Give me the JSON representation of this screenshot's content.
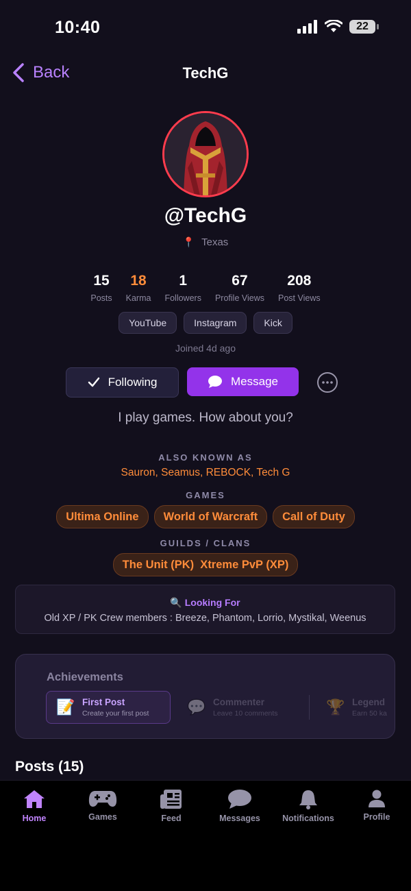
{
  "status_bar": {
    "time": "10:40",
    "battery": "22"
  },
  "nav": {
    "back_label": "Back",
    "title": "TechG"
  },
  "profile": {
    "handle": "@TechG",
    "location": "Texas",
    "stats": [
      {
        "value": "15",
        "label": "Posts"
      },
      {
        "value": "18",
        "label": "Karma"
      },
      {
        "value": "1",
        "label": "Followers"
      },
      {
        "value": "67",
        "label": "Profile Views"
      },
      {
        "value": "208",
        "label": "Post Views"
      }
    ],
    "socials": [
      "YouTube",
      "Instagram",
      "Kick"
    ],
    "joined": "Joined 4d ago",
    "following_label": "Following",
    "message_label": "Message",
    "bio": "I play games. How about you?"
  },
  "aka": {
    "label": "ALSO KNOWN AS",
    "names": "Sauron, Seamus, REBOCK, Tech G"
  },
  "games": {
    "label": "GAMES",
    "items": [
      "Ultima Online",
      "World of Warcraft",
      "Call of Duty"
    ]
  },
  "guilds": {
    "label": "GUILDS / CLANS",
    "items": [
      "The Unit (PK)  Xtreme PvP (XP)"
    ]
  },
  "looking_for": {
    "title": "Looking For",
    "text": "Old XP / PK Crew members : Breeze, Phantom, Lorrio, Mystikal, Weenus"
  },
  "achievements": {
    "title": "Achievements",
    "items": [
      {
        "name": "First Post",
        "desc": "Create your first post",
        "icon": "memo-icon"
      },
      {
        "name": "Commenter",
        "desc": "Leave 10 comments",
        "icon": "speech-bubble-icon"
      },
      {
        "name": "Legend",
        "desc": "Earn 50 ka",
        "icon": "trophy-icon"
      }
    ]
  },
  "posts": {
    "title": "Posts (15)"
  },
  "tabs": [
    {
      "label": "Home"
    },
    {
      "label": "Games"
    },
    {
      "label": "Feed"
    },
    {
      "label": "Messages"
    },
    {
      "label": "Notifications"
    },
    {
      "label": "Profile"
    }
  ],
  "colors": {
    "accent": "#9333ea",
    "highlight": "#ff8c3a",
    "avatar_ring": "#ff3c4d"
  }
}
